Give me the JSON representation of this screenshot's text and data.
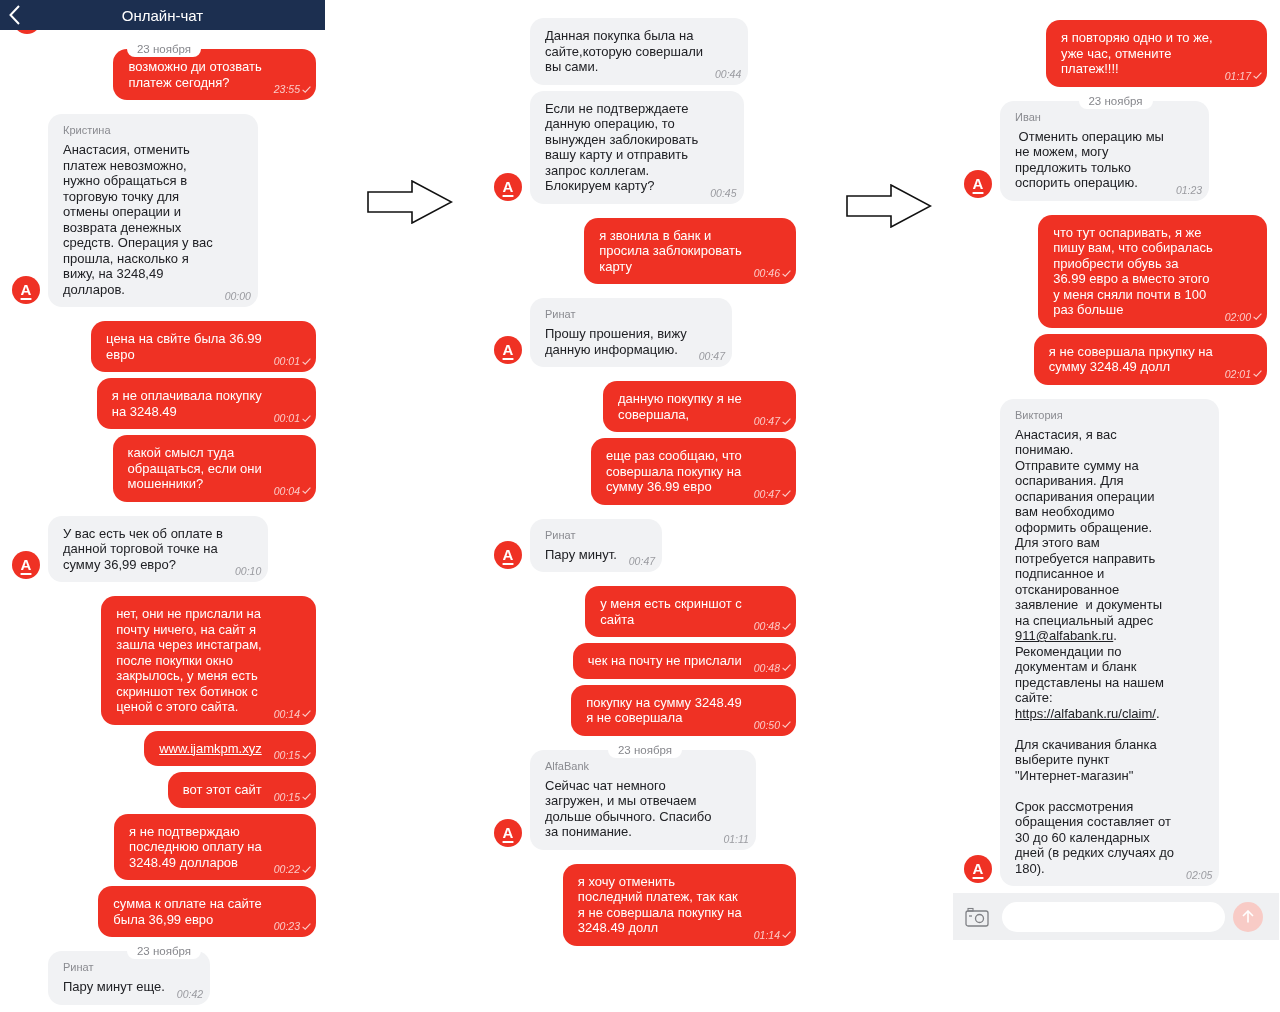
{
  "screens": [
    {
      "header": {
        "title": "Онлайн-чат"
      },
      "messages": [
        {
          "kind": "outgoing",
          "date": "23 ноября",
          "text": "возможно ди отозвать\nплатеж сегодня?",
          "time": "23:55"
        },
        {
          "kind": "incoming",
          "author": "Кристина",
          "text": "Анастасия, отменить\nплатеж невозможно,\nнужно обращаться в\nторговую точку для\nотмены операции и\nвозврата денежных\nсредств. Операция у вас\nпрошла, насколько я\nвижу, на 3248,49\nдолларов.",
          "time": "00:00",
          "avatar": "А"
        },
        {
          "kind": "outgoing",
          "text": "цена на свйте была 36.99\nевро",
          "time": "00:01"
        },
        {
          "kind": "outgoing",
          "text": "я не оплачивала покупку\nна 3248.49",
          "time": "00:01"
        },
        {
          "kind": "outgoing",
          "text": "какой смысл туда\nобращаться, если они\nмошенники?",
          "time": "00:04"
        },
        {
          "kind": "incoming",
          "text": "У вас есть чек об оплате в\nданной торговой точке на\nсумму 36,99 евро?",
          "time": "00:10",
          "avatar": "А"
        },
        {
          "kind": "outgoing",
          "text": "нет, они не прислали на\nпочту ничего, на сайт я\nзашла через инстаграм,\nпосле покупки окно\nзакрылось, у меня есть\nскриншот тех ботинок с\nценой с этого сайта.",
          "time": "00:14"
        },
        {
          "kind": "outgoing",
          "parts": [
            {
              "kind": "link",
              "text": "www.ijamkpm.xyz"
            }
          ],
          "time": "00:15"
        },
        {
          "kind": "outgoing",
          "text": "вот этот сайт",
          "time": "00:15"
        },
        {
          "kind": "outgoing",
          "text": "я не подтверждаю\nпоследнюю оплату на\n3248.49 долларов",
          "time": "00:22"
        },
        {
          "kind": "outgoing",
          "text": "сумма к оплате на сайте\nбыла 36,99 евро",
          "time": "00:23"
        },
        {
          "kind": "incoming",
          "date": "23 ноября",
          "author": "Ринат",
          "text": "Пару минут еще.",
          "time": "00:42"
        }
      ]
    },
    {
      "messages": [
        {
          "kind": "incoming",
          "text": "Данная покупка была на\nсайте,которую совершали\nвы сами.",
          "time": "00:44"
        },
        {
          "kind": "incoming",
          "text": "Если не подтверждаете\nданную операцию, то\nвынужден заблокировать\nвашу карту и отправить\nзапрос коллегам.\nБлокируем карту?",
          "time": "00:45",
          "avatar": "А"
        },
        {
          "kind": "outgoing",
          "text": "я звонила в банк и\nпросила заблокировать\nкарту",
          "time": "00:46"
        },
        {
          "kind": "incoming",
          "author": "Ринат",
          "text": "Прошу прошения, вижу\nданную информацию.",
          "time": "00:47",
          "avatar": "А"
        },
        {
          "kind": "outgoing",
          "text": "данную покупку я не\nсовершала,",
          "time": "00:47"
        },
        {
          "kind": "outgoing",
          "text": "еще раз сообщаю, что\nсовершала покупку на\nсумму 36.99 евро",
          "time": "00:47"
        },
        {
          "kind": "incoming",
          "author": "Ринат",
          "text": "Пару минут.",
          "time": "00:47",
          "avatar": "А"
        },
        {
          "kind": "outgoing",
          "text": "у меня есть скриншот с\nсайта",
          "time": "00:48"
        },
        {
          "kind": "outgoing",
          "text": "чек на почту не прислали",
          "time": "00:48"
        },
        {
          "kind": "outgoing",
          "text": "покупку на сумму 3248.49\nя не совершала",
          "time": "00:50"
        },
        {
          "kind": "incoming",
          "date": "23 ноября",
          "author": "AlfaBank",
          "text": "Сейчас чат немного\nзагружен, и мы отвечаем\nдольше обычного. Спасибо\nза понимание.",
          "time": "01:11",
          "avatar": "А"
        },
        {
          "kind": "outgoing",
          "text": "я хочу отменить\nпоследний платеж, так как\nя не совершала покупку на\n3248.49 долл",
          "time": "01:14"
        }
      ]
    },
    {
      "messages": [
        {
          "kind": "outgoing",
          "text": "я повторяю одно и то же,\nуже час, отмените\nплатеж!!!!",
          "time": "01:17"
        },
        {
          "kind": "incoming",
          "date": "23 ноября",
          "author": "Иван",
          "text": " Отменить операцию мы\nне можем, могу\nпредложить только\nоспорить операцию.",
          "time": "01:23",
          "avatar": "А"
        },
        {
          "kind": "outgoing",
          "text": "что тут оспаривать, я же\nпишу вам, что собиралась\nприобрести обувь за\n36.99 евро а вместо этого\nу меня сняли почти в 100\nраз больше",
          "time": "02:00"
        },
        {
          "kind": "outgoing",
          "text": "я не совершала пркупку на\nсумму 3248.49 долл",
          "time": "02:01"
        },
        {
          "kind": "incoming",
          "author": "Виктория",
          "parts": [
            {
              "kind": "text",
              "text": "Анастасия, я вас\nпонимаю.\nОтправите сумму на\nоспаривания. Для\nоспаривания операции\nвам необходимо\nоформить обращение.\nДля этого вам\nпотребуется направить\nподписанное и\nотсканированное\nзаявление  и документы\nна специальный адрес\n"
            },
            {
              "kind": "link",
              "text": "911@alfabank.ru"
            },
            {
              "kind": "text",
              "text": ".\nРекомендации по\nдокументам и бланк\nпредставлены на нашем\nсайте:\n"
            },
            {
              "kind": "link",
              "text": "https://alfabank.ru/claim/"
            },
            {
              "kind": "text",
              "text": ".\n\nДля скачивания бланка\nвыберите пункт\n\"Интернет-магазин\"\n\nСрок рассмотрения\nобращения составляет от\n30 до 60 календарных\nдней (в редких случаях до\n180)."
            }
          ],
          "time": "02:05",
          "avatar": "А"
        }
      ],
      "composer": {
        "send_button": {
          "disabled": true
        }
      }
    }
  ]
}
